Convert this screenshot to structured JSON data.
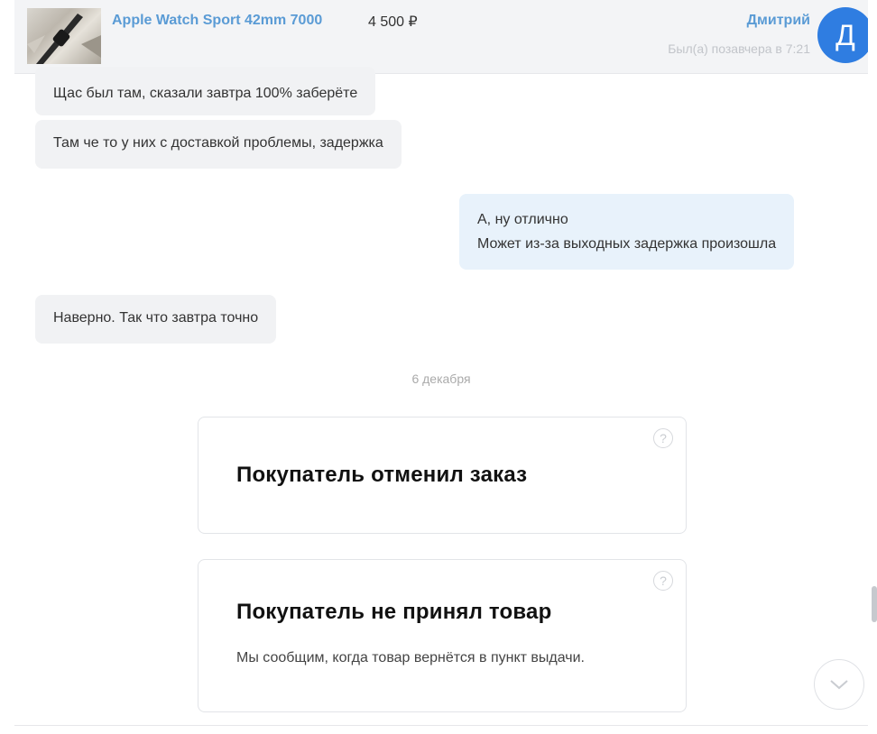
{
  "header": {
    "product_title": "Apple Watch Sport 42mm 7000",
    "price": "4 500 ₽",
    "seller_name": "Дмитрий",
    "seller_status": "Был(а) позавчера в 7:21",
    "avatar_letter": "Д"
  },
  "messages": [
    {
      "side": "in",
      "text": "Щас был там, сказали завтра 100% заберёте"
    },
    {
      "side": "in",
      "text": "Там че то у них с доставкой проблемы, задержка"
    },
    {
      "side": "out",
      "lines": [
        "А, ну отлично",
        "Может из-за выходных задержка произошла"
      ]
    },
    {
      "side": "in",
      "text": "Наверно. Так что завтра точно"
    }
  ],
  "date_divider": "6 декабря",
  "status_cards": [
    {
      "title": "Покупатель отменил заказ"
    },
    {
      "title": "Покупатель не принял товар",
      "text": "Мы сообщим, когда товар вернётся в пункт выдачи."
    }
  ],
  "icons": {
    "help": "question-circle-icon",
    "scroll_down": "chevron-down-icon"
  },
  "colors": {
    "link": "#5a9bd5",
    "avatar": "#2f7de1",
    "incoming_bubble": "#f1f2f4",
    "outgoing_bubble": "#e8f2fb"
  }
}
